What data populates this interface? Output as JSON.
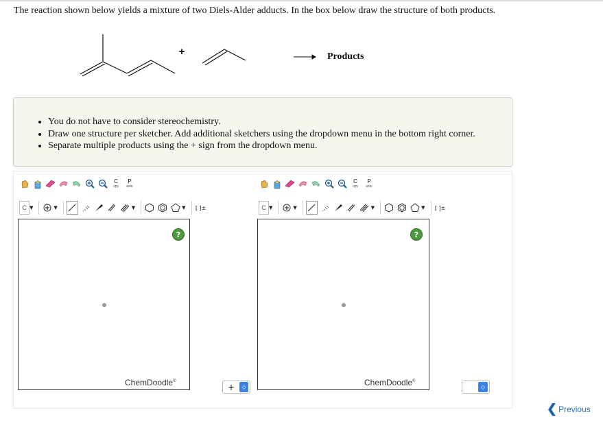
{
  "question": "The reaction shown below yields a mixture of two Diels-Alder adducts. In the box below draw the structure of both products.",
  "reaction": {
    "plus": "+",
    "arrow": "⟶",
    "products": "Products"
  },
  "instructions": [
    "You do not have to consider stereochemistry.",
    "Draw one structure per sketcher. Add additional sketchers using the dropdown menu in the bottom right corner.",
    "Separate multiple products using the + sign from the dropdown menu."
  ],
  "sketchers": [
    {
      "element": "C",
      "brand": "ChemDoodle",
      "help": "?",
      "copy_top": "C",
      "copy_bottom": "opy",
      "paste_top": "P",
      "paste_bottom": "aste",
      "brackets": "[ ]±",
      "join_value": "+"
    },
    {
      "element": "C",
      "brand": "ChemDoodle",
      "help": "?",
      "copy_top": "C",
      "copy_bottom": "opy",
      "paste_top": "P",
      "paste_bottom": "aste",
      "brackets": "[ ]±",
      "join_value": ""
    }
  ],
  "nav": {
    "previous": "Previous"
  },
  "colors": {
    "accent_blue": "#3b82e6",
    "help_green": "#4c9a3b",
    "panel_bg": "#f6f6ef"
  },
  "icons": [
    "hand-icon",
    "eraser-icon",
    "lasso-icon",
    "zoom-in-icon",
    "zoom-out-icon",
    "copy-icon",
    "paste-icon",
    "charge-icon",
    "single-bond-icon",
    "wedge-bond-icon",
    "double-bond-icon",
    "cyclohexane-icon",
    "benzene-icon",
    "cyclopentane-icon"
  ]
}
